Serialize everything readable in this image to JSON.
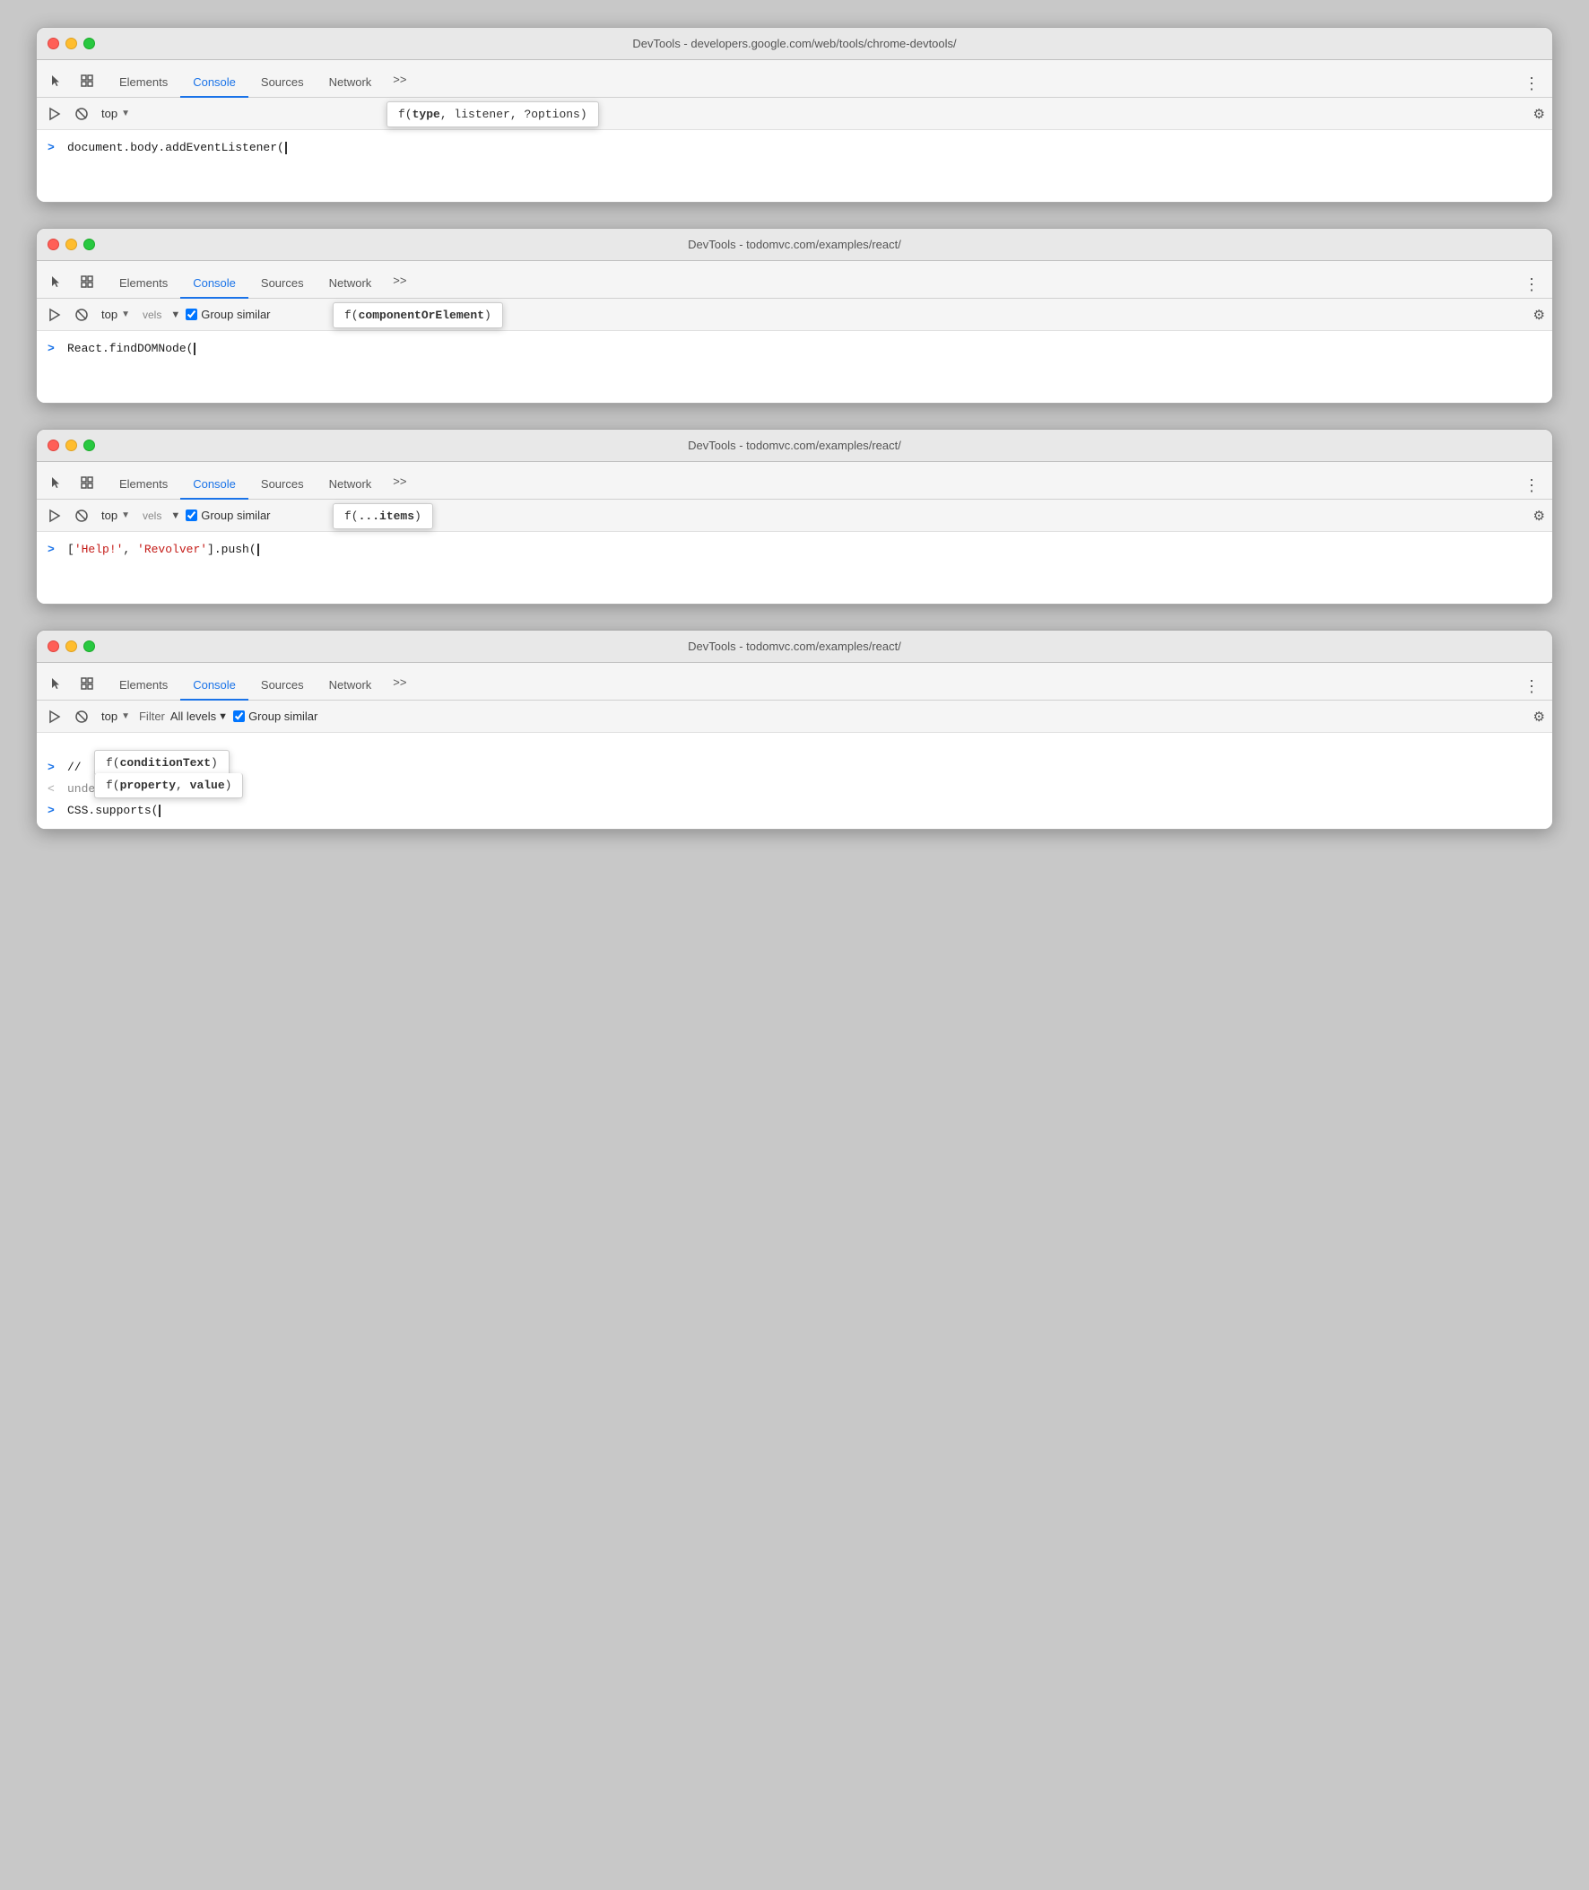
{
  "windows": [
    {
      "id": "window-1",
      "title": "DevTools - developers.google.com/web/tools/chrome-devtools/",
      "tabs": [
        "Elements",
        "Console",
        "Sources",
        "Network",
        ">>"
      ],
      "active_tab": "Console",
      "toolbar": {
        "context": "top",
        "show_filter": false,
        "show_levels": false,
        "show_group_similar": false
      },
      "autocomplete": {
        "visible": true,
        "text": "f(type, listener, ?options)",
        "bold_param": "type",
        "position": "toolbar"
      },
      "console_lines": [
        {
          "type": "input",
          "prompt": ">",
          "text": "document.body.addEventListener("
        }
      ]
    },
    {
      "id": "window-2",
      "title": "DevTools - todomvc.com/examples/react/",
      "tabs": [
        "Elements",
        "Console",
        "Sources",
        "Network",
        ">>"
      ],
      "active_tab": "Console",
      "toolbar": {
        "context": "top",
        "show_filter": false,
        "show_levels": true,
        "show_group_similar": true
      },
      "autocomplete": {
        "visible": true,
        "text": "f(componentOrElement)",
        "bold_param": "componentOrElement",
        "position": "toolbar"
      },
      "console_lines": [
        {
          "type": "input",
          "prompt": ">",
          "text": "React.findDOMNode("
        }
      ]
    },
    {
      "id": "window-3",
      "title": "DevTools - todomvc.com/examples/react/",
      "tabs": [
        "Elements",
        "Console",
        "Sources",
        "Network",
        ">>"
      ],
      "active_tab": "Console",
      "toolbar": {
        "context": "top",
        "show_filter": false,
        "show_levels": true,
        "show_group_similar": true
      },
      "autocomplete": {
        "visible": true,
        "text": "f(...items)",
        "bold_param": "...items",
        "position": "toolbar"
      },
      "console_lines": [
        {
          "type": "input",
          "prompt": ">",
          "text_parts": [
            {
              "type": "plain",
              "text": "["
            },
            {
              "type": "string",
              "text": "'Help!'"
            },
            {
              "type": "plain",
              "text": ", "
            },
            {
              "type": "string",
              "text": "'Revolver'"
            },
            {
              "type": "plain",
              "text": "].push("
            }
          ]
        }
      ]
    },
    {
      "id": "window-4",
      "title": "DevTools - todomvc.com/examples/react/",
      "tabs": [
        "Elements",
        "Console",
        "Sources",
        "Network",
        ">>"
      ],
      "active_tab": "Console",
      "toolbar": {
        "context": "top",
        "filter_label": "Filter",
        "levels_label": "All levels",
        "show_levels": true,
        "show_group_similar": true
      },
      "autocomplete_multi": [
        {
          "visible": true,
          "text": "f(conditionText)",
          "bold_param": "conditionText"
        },
        {
          "visible": true,
          "text": "f(property, value)",
          "bold_param": "property",
          "bold_param2": "value"
        }
      ],
      "console_lines": [
        {
          "type": "input",
          "prompt": ">",
          "text": "//"
        },
        {
          "type": "output",
          "prompt": "<",
          "text": "undefined"
        },
        {
          "type": "input",
          "prompt": ">",
          "text": "CSS.supports("
        }
      ]
    }
  ],
  "labels": {
    "elements": "Elements",
    "console": "Console",
    "sources": "Sources",
    "network": "Network",
    "more": ">>",
    "top": "top",
    "filter": "Filter",
    "all_levels": "All levels",
    "group_similar": "Group similar"
  }
}
